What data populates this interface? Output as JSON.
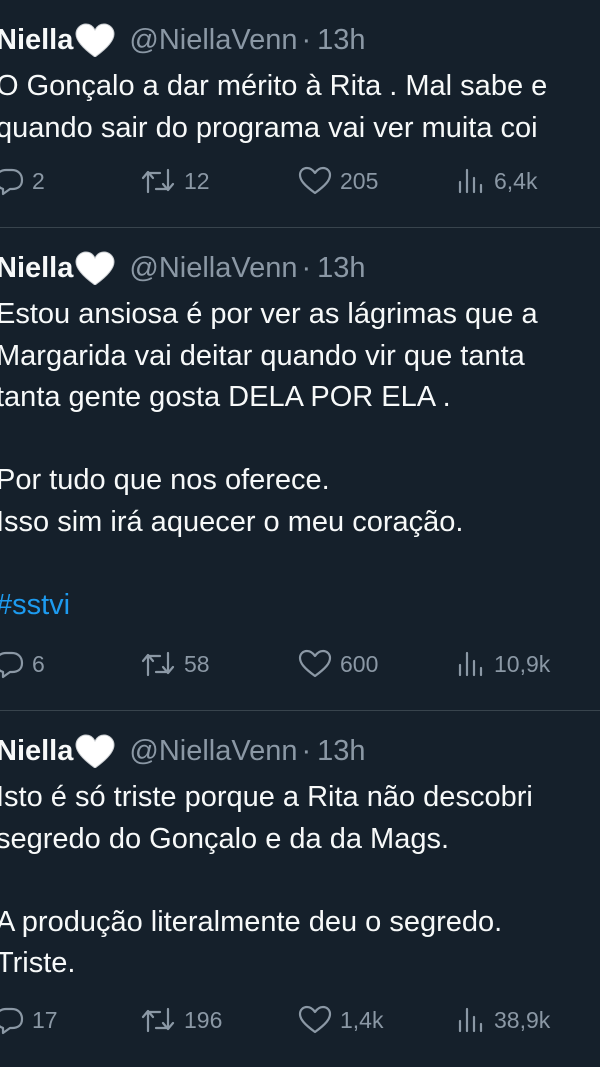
{
  "tweets": [
    {
      "name": "Niella",
      "emoji": "white-heart",
      "handle": "@NiellaVenn",
      "separator": "·",
      "time": "13h",
      "lines": [
        "O Gonçalo a dar mérito à Rita . Mal sabe e",
        "quando sair do programa vai ver muita coi"
      ],
      "stats": {
        "replies": "2",
        "retweets": "12",
        "likes": "205",
        "views": "6,4k"
      }
    },
    {
      "name": "Niella",
      "emoji": "white-heart",
      "handle": "@NiellaVenn",
      "separator": "·",
      "time": "13h",
      "lines": [
        "Estou ansiosa é por ver as lágrimas que a",
        "Margarida vai deitar quando vir que tanta",
        "tanta gente gosta DELA POR ELA .",
        "",
        "Por tudo que nos oferece.",
        "Isso sim irá aquecer o meu coração.",
        ""
      ],
      "hashtag": "#sstvi",
      "stats": {
        "replies": "6",
        "retweets": "58",
        "likes": "600",
        "views": "10,9k"
      }
    },
    {
      "name": "Niella",
      "emoji": "white-heart",
      "handle": "@NiellaVenn",
      "separator": "·",
      "time": "13h",
      "lines": [
        "Isto é só triste porque a Rita não descobri",
        "segredo do Gonçalo e da da Mags.",
        "",
        "A produção literalmente deu o segredo.",
        "Triste."
      ],
      "stats": {
        "replies": "17",
        "retweets": "196",
        "likes": "1,4k",
        "views": "38,9k"
      }
    }
  ],
  "colors": {
    "background": "#15202b",
    "text": "#f7f9f9",
    "muted": "#8b98a5",
    "link": "#1d9bf0",
    "divider": "#38444d"
  },
  "icons": [
    "reply-icon",
    "retweet-icon",
    "like-icon",
    "views-icon",
    "white-heart-emoji"
  ]
}
